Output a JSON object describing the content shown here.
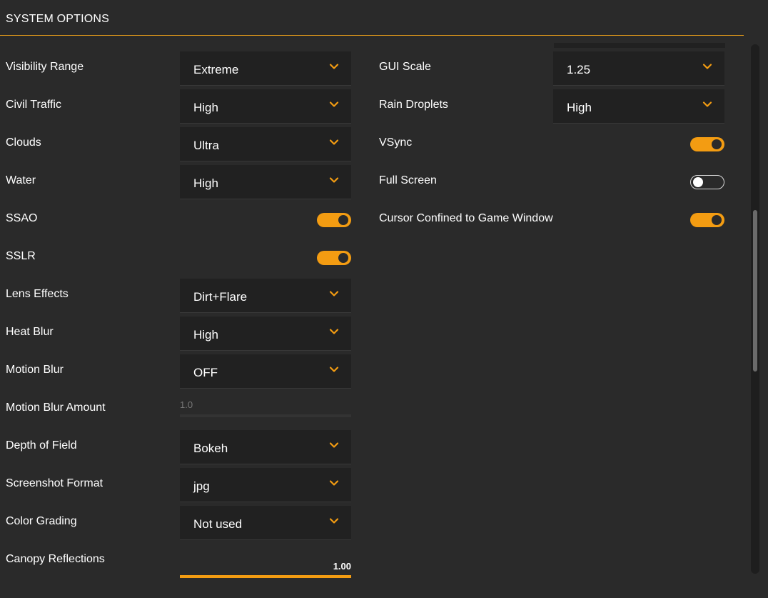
{
  "section": {
    "title": "SYSTEM OPTIONS"
  },
  "colors": {
    "accent": "#f39c12",
    "background": "#2a2a2a",
    "control_bg": "#212121"
  },
  "left": [
    {
      "id": "visibility-range",
      "label": "Visibility Range",
      "kind": "dropdown",
      "value": "Extreme"
    },
    {
      "id": "civil-traffic",
      "label": "Civil Traffic",
      "kind": "dropdown",
      "value": "High"
    },
    {
      "id": "clouds",
      "label": "Clouds",
      "kind": "dropdown",
      "value": "Ultra"
    },
    {
      "id": "water",
      "label": "Water",
      "kind": "dropdown",
      "value": "High"
    },
    {
      "id": "ssao",
      "label": "SSAO",
      "kind": "toggle",
      "on": true
    },
    {
      "id": "sslr",
      "label": "SSLR",
      "kind": "toggle",
      "on": true
    },
    {
      "id": "lens-effects",
      "label": "Lens Effects",
      "kind": "dropdown",
      "value": "Dirt+Flare"
    },
    {
      "id": "heat-blur",
      "label": "Heat Blur",
      "kind": "dropdown",
      "value": "High"
    },
    {
      "id": "motion-blur",
      "label": "Motion Blur",
      "kind": "dropdown",
      "value": "OFF"
    },
    {
      "id": "motion-blur-amount",
      "label": "Motion Blur Amount",
      "kind": "slider-disabled",
      "value": "1.0"
    },
    {
      "id": "depth-of-field",
      "label": "Depth of Field",
      "kind": "dropdown",
      "value": "Bokeh"
    },
    {
      "id": "screenshot-format",
      "label": "Screenshot Format",
      "kind": "dropdown",
      "value": "jpg"
    },
    {
      "id": "color-grading",
      "label": "Color Grading",
      "kind": "dropdown",
      "value": "Not used"
    },
    {
      "id": "canopy-reflections",
      "label": "Canopy Reflections",
      "kind": "slider",
      "value": "1.00",
      "fill": 1.0
    }
  ],
  "right": [
    {
      "id": "gui-scale",
      "label": "GUI Scale",
      "kind": "dropdown",
      "value": "1.25"
    },
    {
      "id": "rain-droplets",
      "label": "Rain Droplets",
      "kind": "dropdown",
      "value": "High"
    },
    {
      "id": "vsync",
      "label": "VSync",
      "kind": "toggle",
      "on": true
    },
    {
      "id": "full-screen",
      "label": "Full Screen",
      "kind": "toggle",
      "on": false
    },
    {
      "id": "cursor-confined",
      "label": "Cursor Confined to Game Window",
      "kind": "toggle",
      "on": true
    }
  ],
  "scroll": {
    "position": 0.31,
    "visible_fraction": 0.31
  }
}
